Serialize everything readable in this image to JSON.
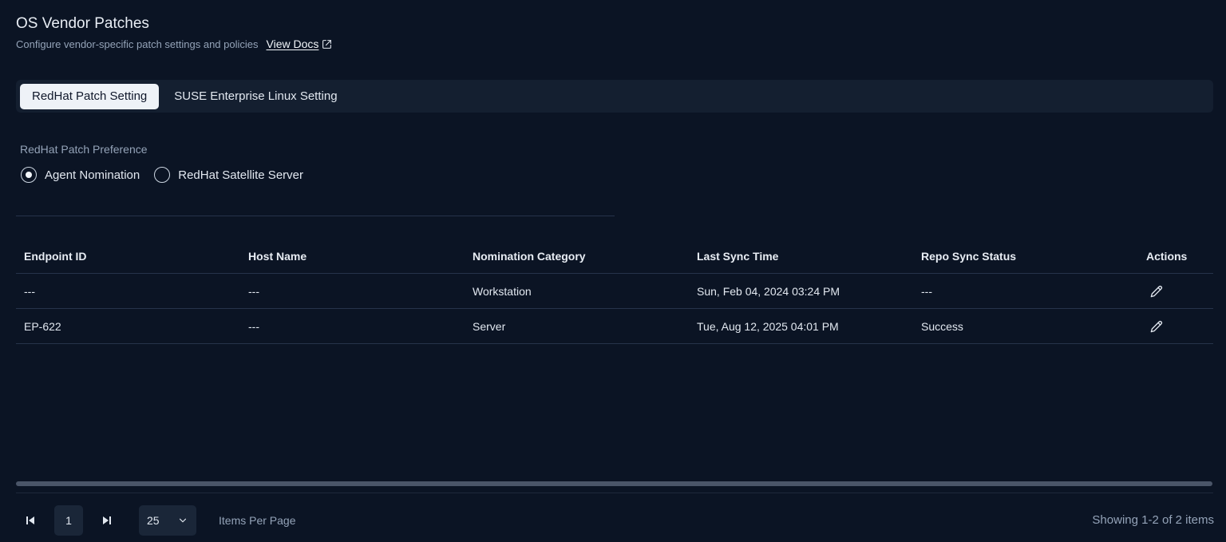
{
  "header": {
    "title": "OS Vendor Patches",
    "subtitle": "Configure vendor-specific patch settings and policies",
    "docs_link": "View Docs"
  },
  "tabs": [
    {
      "label": "RedHat Patch Setting",
      "active": true
    },
    {
      "label": "SUSE Enterprise Linux Setting",
      "active": false
    }
  ],
  "preference": {
    "label": "RedHat Patch Preference",
    "options": [
      {
        "label": "Agent Nomination",
        "selected": true
      },
      {
        "label": "RedHat Satellite Server",
        "selected": false
      }
    ]
  },
  "table": {
    "columns": [
      "Endpoint ID",
      "Host Name",
      "Nomination Category",
      "Last Sync Time",
      "Repo Sync Status",
      "Actions"
    ],
    "rows": [
      {
        "endpoint_id": "---",
        "host_name": "---",
        "category": "Workstation",
        "last_sync": "Sun, Feb 04, 2024 03:24 PM",
        "status": "---",
        "action_icon": "pencil-icon"
      },
      {
        "endpoint_id": "EP-622",
        "host_name": "---",
        "category": "Server",
        "last_sync": "Tue, Aug 12, 2025 04:01 PM",
        "status": "Success",
        "action_icon": "pencil-icon"
      }
    ]
  },
  "pagination": {
    "current_page": "1",
    "per_page": "25",
    "per_page_label": "Items Per Page",
    "showing": "Showing 1-2 of 2 items"
  },
  "colors": {
    "background": "#0b1424",
    "tab_bar": "#141f30",
    "active_tab": "#eef2f7",
    "border": "#26334a"
  }
}
